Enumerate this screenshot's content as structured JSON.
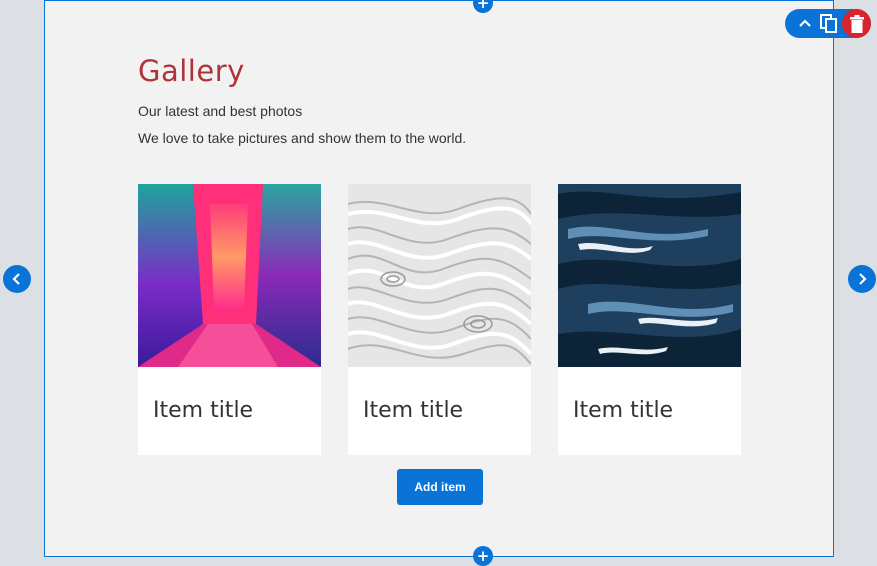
{
  "gallery": {
    "title": "Gallery",
    "subtitle": "Our latest and best photos",
    "description": "We love to take pictures and show them to the world.",
    "items": [
      {
        "title": "Item title",
        "image": "neon-corridor"
      },
      {
        "title": "Item title",
        "image": "white-paper-swirls"
      },
      {
        "title": "Item title",
        "image": "blue-paint-waves"
      }
    ],
    "add_label": "Add item"
  },
  "icons": {
    "add_section_top": "plus-icon",
    "add_section_bottom": "plus-icon",
    "move_up": "chevron-up-icon",
    "duplicate": "copy-icon",
    "delete": "trash-icon",
    "prev": "chevron-left-icon",
    "next": "chevron-right-icon"
  },
  "colors": {
    "accent": "#0a73d8",
    "title": "#b0333a",
    "delete": "#d8242d",
    "section_bg": "#f2f2f3",
    "page_bg": "#dce0e5"
  }
}
